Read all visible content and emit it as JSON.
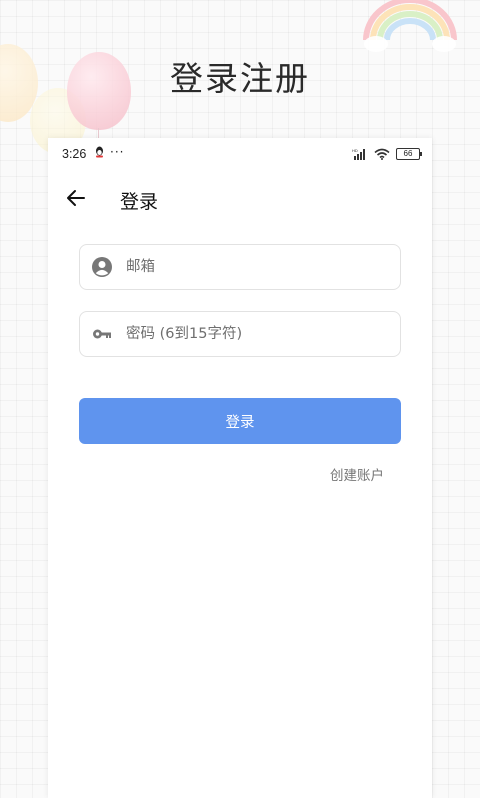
{
  "banner": {
    "title": "登录注册"
  },
  "status_bar": {
    "time": "3:26",
    "dots": "···",
    "battery": "66"
  },
  "topbar": {
    "title": "登录"
  },
  "form": {
    "email_placeholder": "邮箱",
    "password_placeholder": "密码 (6到15字符)",
    "login_label": "登录",
    "create_account_label": "创建账户"
  },
  "colors": {
    "accent": "#5f94ee",
    "background": "#fafafa"
  },
  "icons": {
    "back": "arrow-left-icon",
    "email": "account-circle-icon",
    "password": "key-icon"
  }
}
